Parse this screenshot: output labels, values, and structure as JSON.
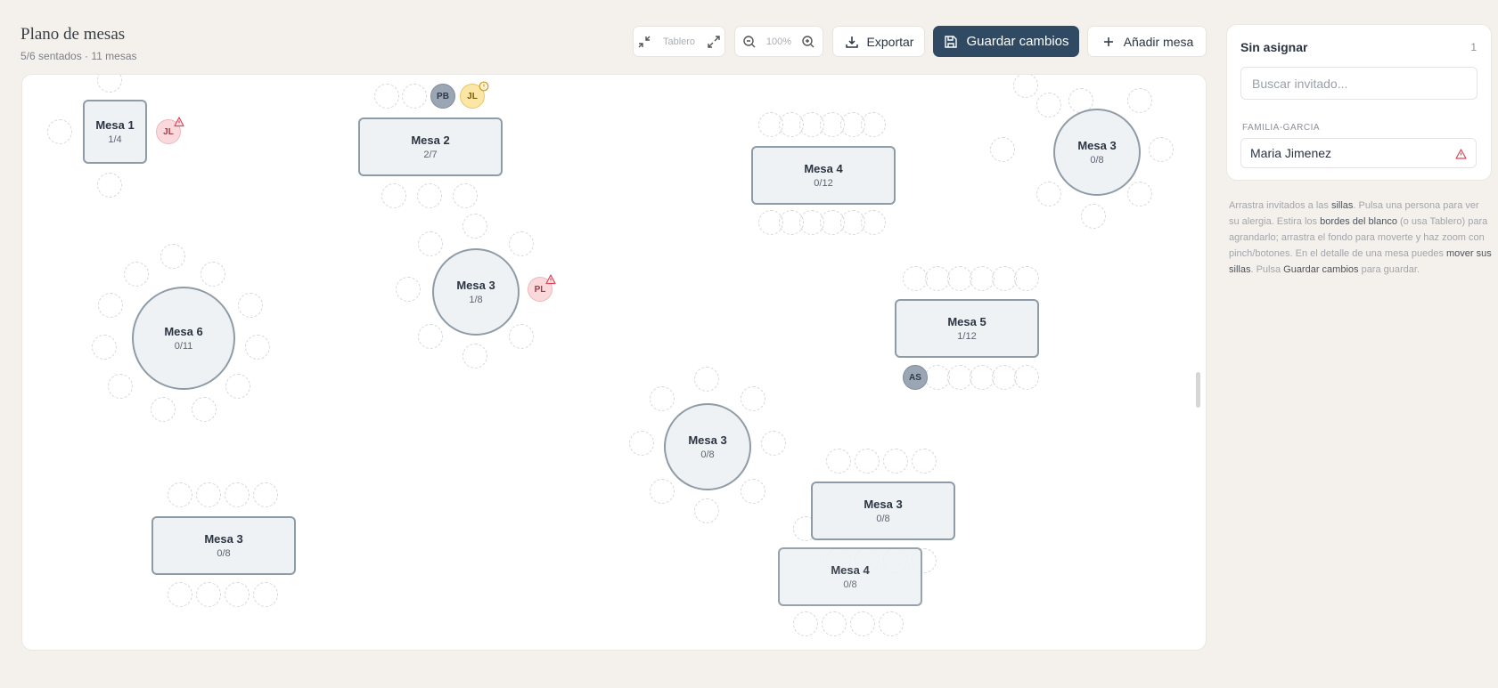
{
  "header": {
    "title": "Plano de mesas",
    "subtitle": "5/6 sentados · 11 mesas"
  },
  "toolbar": {
    "view_label": "Tablero",
    "zoom_label": "100%",
    "export_label": "Exportar",
    "save_label": "Guardar cambios",
    "add_label": "Añadir mesa"
  },
  "colors": {
    "primary": "#2f4a62",
    "canvas": "#ffffff",
    "table_fill": "#eef2f5",
    "table_border": "#8f9ba6",
    "warning": "#d9485a"
  },
  "tables": [
    {
      "name": "Mesa 1",
      "count": "1/4"
    },
    {
      "name": "Mesa 2",
      "count": "2/7"
    },
    {
      "name": "Mesa 4",
      "count": "0/12"
    },
    {
      "name": "Mesa 3",
      "count": "0/8"
    },
    {
      "name": "Mesa 6",
      "count": "0/11"
    },
    {
      "name": "Mesa 3",
      "count": "1/8"
    },
    {
      "name": "Mesa 5",
      "count": "1/12"
    },
    {
      "name": "Mesa 3",
      "count": "0/8"
    },
    {
      "name": "Mesa 3",
      "count": "0/8"
    },
    {
      "name": "Mesa 3",
      "count": "0/8"
    },
    {
      "name": "Mesa 4",
      "count": "0/8"
    }
  ],
  "guests": [
    {
      "initials": "JL",
      "allergy": true
    },
    {
      "initials": "PB",
      "allergy": false
    },
    {
      "initials": "JL",
      "allergy": true
    },
    {
      "initials": "PL",
      "allergy": true
    },
    {
      "initials": "AS",
      "allergy": false
    }
  ],
  "sidebar": {
    "title": "Sin asignar",
    "count": "1",
    "search_placeholder": "Buscar invitado...",
    "group_label": "FAMILIA-GARCIA",
    "guest_name": "Maria Jimenez",
    "help": {
      "t1": "Arrastra invitados a las ",
      "b1": "sillas",
      "t2": ". Pulsa una persona para ver su alergia. Estira los ",
      "b2": "bordes del blanco",
      "t3": " (o usa Tablero) para agrandarlo; arrastra el fondo para moverte y haz zoom con pinch/botones. En el detalle de una mesa puedes ",
      "b3": "mover sus sillas",
      "t4": ". Pulsa ",
      "b4": "Guardar cambios",
      "t5": " para guardar."
    }
  }
}
